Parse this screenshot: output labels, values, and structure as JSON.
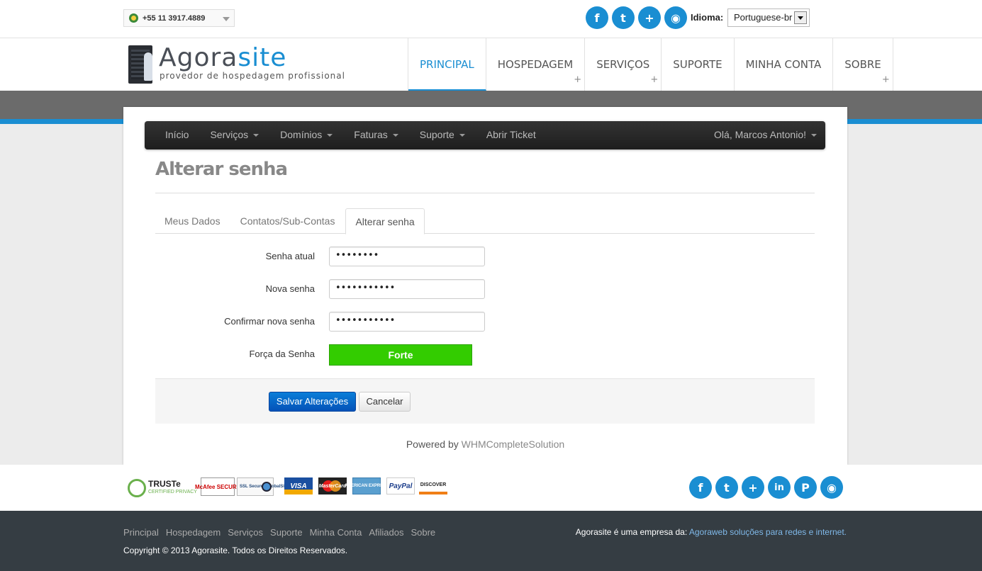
{
  "topbar": {
    "phone": "+55 11 3917.4889",
    "social": [
      {
        "icon": "facebook-icon",
        "glyph": "f"
      },
      {
        "icon": "twitter-icon",
        "glyph": "t"
      },
      {
        "icon": "plus-icon",
        "glyph": "+"
      },
      {
        "icon": "rss-icon",
        "glyph": "◉"
      }
    ],
    "language_label": "Idioma:",
    "language_value": "Portuguese-br"
  },
  "header": {
    "logo_prefix": "Agora",
    "logo_suffix": "site",
    "logo_tagline": "provedor de hospedagem profissional",
    "nav": [
      {
        "label": "PRINCIPAL",
        "active": true,
        "has_plus": false
      },
      {
        "label": "HOSPEDAGEM",
        "active": false,
        "has_plus": true
      },
      {
        "label": "SERVIÇOS",
        "active": false,
        "has_plus": true
      },
      {
        "label": "SUPORTE",
        "active": false,
        "has_plus": false
      },
      {
        "label": "MINHA CONTA",
        "active": false,
        "has_plus": false
      },
      {
        "label": "SOBRE",
        "active": false,
        "has_plus": true
      }
    ]
  },
  "subnav": {
    "items": [
      "Início",
      "Serviços",
      "Domínios",
      "Faturas",
      "Suporte",
      "Abrir Ticket"
    ],
    "user": "Olá, Marcos Antonio!"
  },
  "page": {
    "title": "Alterar senha",
    "tabs": [
      "Meus Dados",
      "Contatos/Sub-Contas",
      "Alterar senha"
    ],
    "active_tab": 2
  },
  "form": {
    "current_label": "Senha atual",
    "current_value": "••••••••",
    "new_label": "Nova senha",
    "new_value": "•••••••••••",
    "confirm_label": "Confirmar nova senha",
    "confirm_value": "•••••••••••",
    "strength_label": "Força da Senha",
    "strength_value": "Forte",
    "save_label": "Salvar Alterações",
    "cancel_label": "Cancelar"
  },
  "powered": {
    "prefix": "Powered by",
    "link": "WHMCompleteSolution"
  },
  "badges": {
    "truste": "TRUSTe",
    "truste_sub": "CERTIFIED PRIVACY",
    "mcafee": "McAfee SECURE",
    "globalsign": "SSL Secured GlobalSign",
    "visa": "VISA",
    "mastercard": "MasterCard",
    "amex": "AMERICAN EXPRESS",
    "paypal": "PayPal",
    "discover": "DISCOVER"
  },
  "footer": {
    "links": [
      "Principal",
      "Hospedagem",
      "Serviços",
      "Suporte",
      "Minha Conta",
      "Afiliados",
      "Sobre"
    ],
    "copyright": "Copyright © 2013 Agorasite. Todos os Direitos Reservados.",
    "company_prefix": "Agorasite é uma empresa da:",
    "company_link": "Agoraweb soluções para redes e internet.",
    "social": [
      {
        "icon": "facebook-icon",
        "glyph": "f"
      },
      {
        "icon": "twitter-icon",
        "glyph": "t"
      },
      {
        "icon": "plus-icon",
        "glyph": "+"
      },
      {
        "icon": "linkedin-icon",
        "glyph": "in"
      },
      {
        "icon": "pinterest-icon",
        "glyph": "P"
      },
      {
        "icon": "rss-icon",
        "glyph": "◉"
      }
    ]
  },
  "colors": {
    "accent": "#1a8ed2",
    "strength_strong": "#33cc00",
    "footer_bg": "#353d43"
  }
}
